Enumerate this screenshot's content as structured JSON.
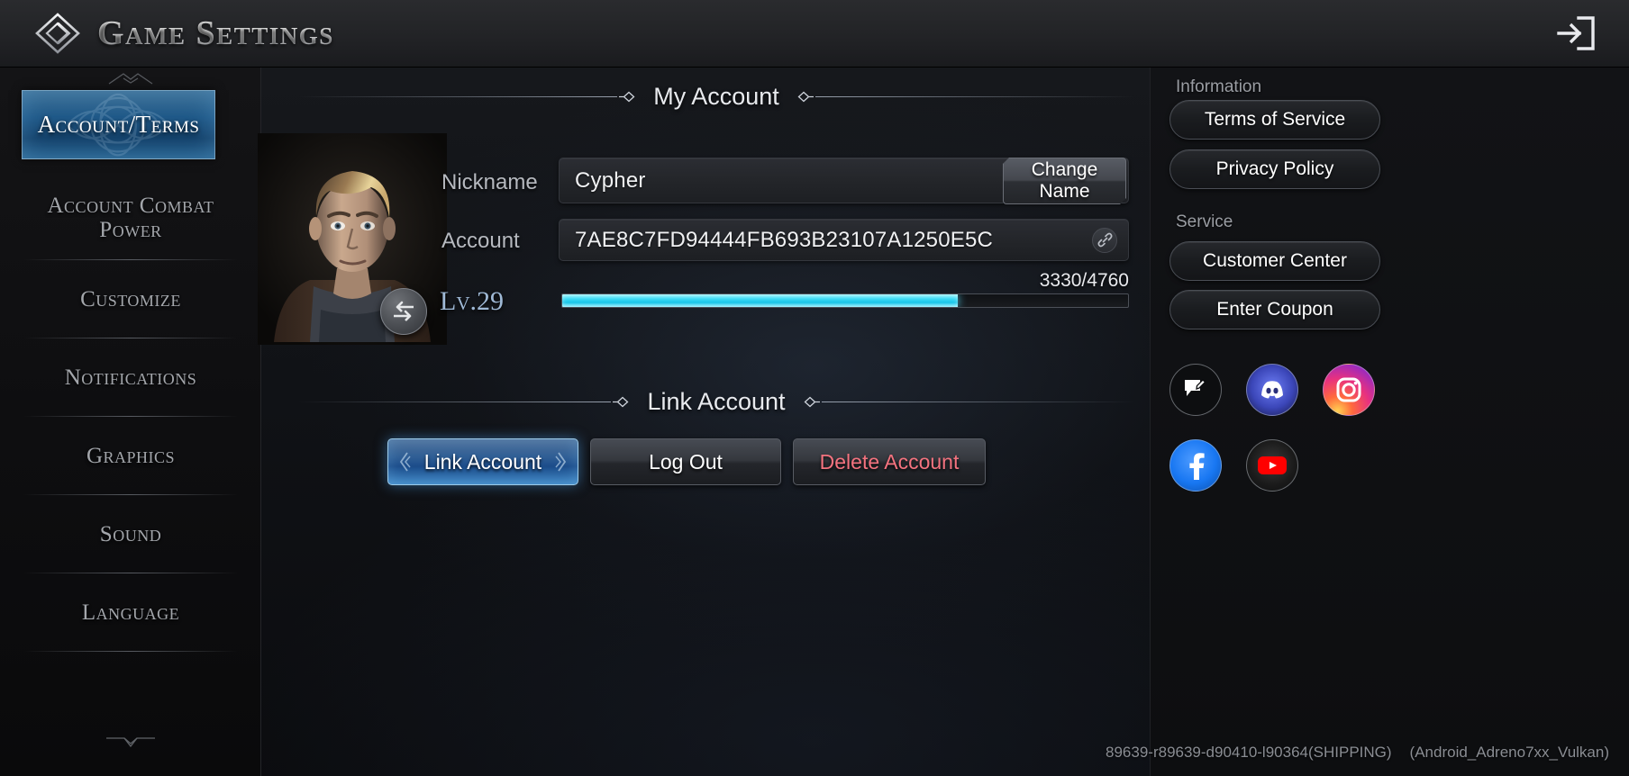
{
  "header": {
    "title": "Game Settings",
    "logo_icon": "triangle-emblem-icon",
    "exit_icon": "exit-door-icon"
  },
  "sidebar": {
    "items": [
      {
        "label": "Account/Terms",
        "active": true
      },
      {
        "label": "Account Combat Power",
        "active": false
      },
      {
        "label": "Customize",
        "active": false
      },
      {
        "label": "Notifications",
        "active": false
      },
      {
        "label": "Graphics",
        "active": false
      },
      {
        "label": "Sound",
        "active": false
      },
      {
        "label": "Language",
        "active": false
      }
    ]
  },
  "main": {
    "my_account": {
      "section_title": "My Account",
      "nickname_label": "Nickname",
      "nickname_value": "Cypher",
      "change_name_line1": "Change",
      "change_name_line2": "Name",
      "account_label": "Account",
      "account_value": "7AE8C7FD94444FB693B23107A1250E5C",
      "copy_icon": "link-copy-icon",
      "level_label": "Lv.29",
      "xp_current": 3330,
      "xp_max": 4760,
      "xp_text": "3330/4760",
      "xp_percent": 69.9,
      "swap_icon": "swap-arrows-icon",
      "portrait_alt": "character-portrait"
    },
    "link_account": {
      "section_title": "Link Account",
      "buttons": [
        {
          "label": "Link Account",
          "style": "primary"
        },
        {
          "label": "Log Out",
          "style": "plain"
        },
        {
          "label": "Delete Account",
          "style": "danger"
        }
      ]
    }
  },
  "right_panel": {
    "information_label": "Information",
    "information_buttons": [
      {
        "label": "Terms of Service"
      },
      {
        "label": "Privacy Policy"
      }
    ],
    "service_label": "Service",
    "service_buttons": [
      {
        "label": "Customer Center"
      },
      {
        "label": "Enter Coupon"
      }
    ],
    "social": [
      {
        "name": "forum-icon",
        "title": "Forum"
      },
      {
        "name": "discord-icon",
        "title": "Discord"
      },
      {
        "name": "instagram-icon",
        "title": "Instagram"
      },
      {
        "name": "facebook-icon",
        "title": "Facebook"
      },
      {
        "name": "youtube-icon",
        "title": "YouTube"
      }
    ]
  },
  "footer": {
    "build_version": "89639-r89639-d90410-l90364(SHIPPING)",
    "platform": "(Android_Adreno7xx_Vulkan)"
  },
  "colors": {
    "accent_blue": "#3f86c4",
    "xp_cyan": "#3edcf5",
    "danger_red": "#f4737f",
    "background": "#0b0c0f"
  }
}
